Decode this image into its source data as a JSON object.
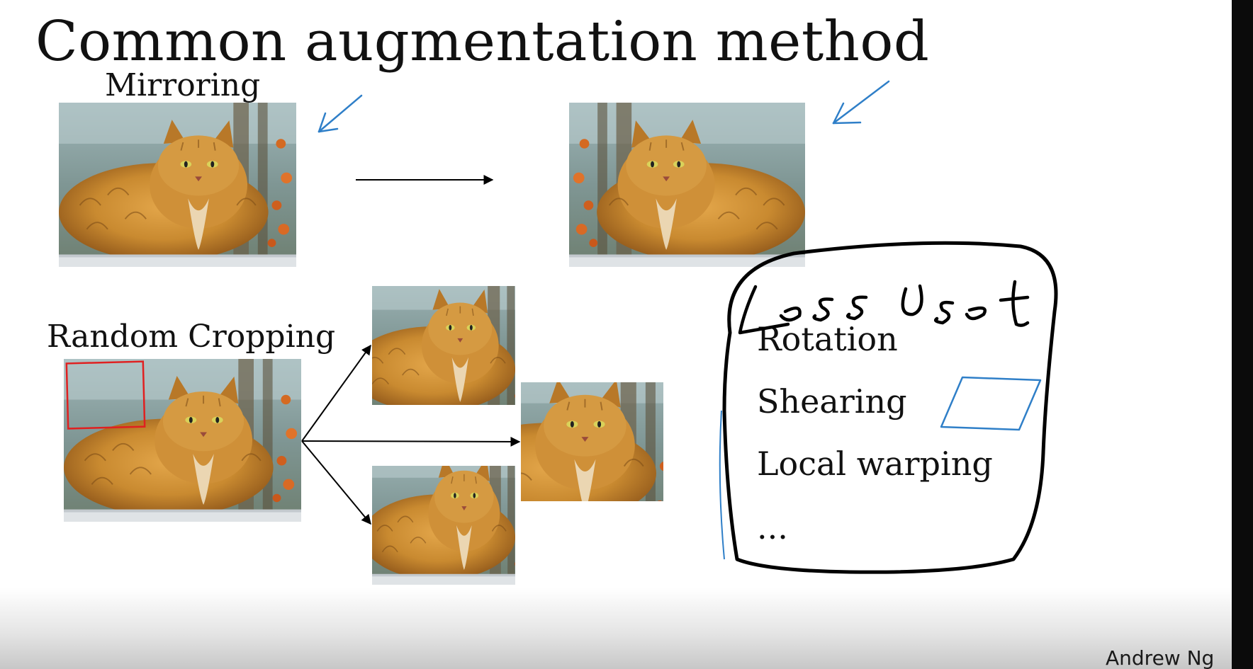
{
  "slide": {
    "title": "Common augmentation method",
    "sections": {
      "mirroring": {
        "label": "Mirroring"
      },
      "cropping": {
        "label": "Random Cropping"
      }
    },
    "methods_list": [
      "Rotation",
      "Shearing",
      "Local warping",
      "..."
    ],
    "annotation": "Less Used",
    "credit": "Andrew Ng"
  },
  "colors": {
    "pen_blue": "#2f7fc8",
    "pen_black": "#000000",
    "crop_box_red": "#e02020",
    "fur": "#c9882e",
    "fur_dark": "#7a4a16",
    "background_blur": "#8fa6a6"
  },
  "icons": [
    "arrow-right-icon",
    "pen-arrow-icon",
    "parallelogram-sketch-icon"
  ]
}
